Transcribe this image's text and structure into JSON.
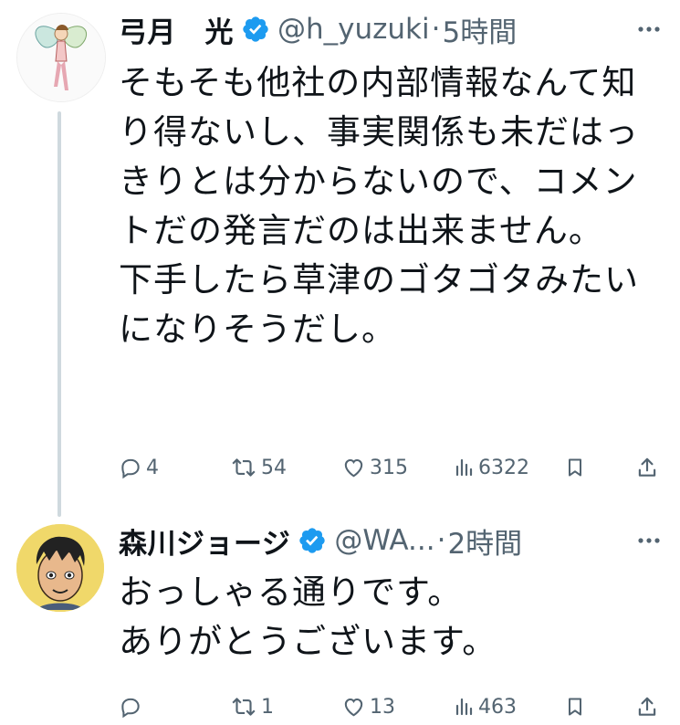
{
  "tweets": [
    {
      "name": "弓月　光",
      "handle": "@h_yuzuki",
      "time": "5時間",
      "text": "そもそも他社の内部情報なんて知り得ないし、事実関係も未だはっきりとは分からないので、コメントだの発言だのは出来ません。\n下手したら草津のゴタゴタみたいになりそうだし。",
      "replies": "4",
      "retweets": "54",
      "likes": "315",
      "views": "6322"
    },
    {
      "name": "森川ジョージ",
      "handle": "@WA...",
      "time": "2時間",
      "text": "おっしゃる通りです。\nありがとうございます。",
      "replies": "",
      "retweets": "1",
      "likes": "13",
      "views": "463"
    }
  ],
  "separator": "·",
  "icons": {
    "verified": "verified-badge-icon",
    "more": "more-dots-icon",
    "reply": "reply-bubble-icon",
    "retweet": "retweet-icon",
    "like": "heart-icon",
    "views": "views-bars-icon",
    "bookmark": "bookmark-icon",
    "share": "share-icon"
  },
  "colors": {
    "verified": "#1d9bf0",
    "text": "#0f1419",
    "secondary": "#536471",
    "thread_line": "#cfd9de"
  }
}
